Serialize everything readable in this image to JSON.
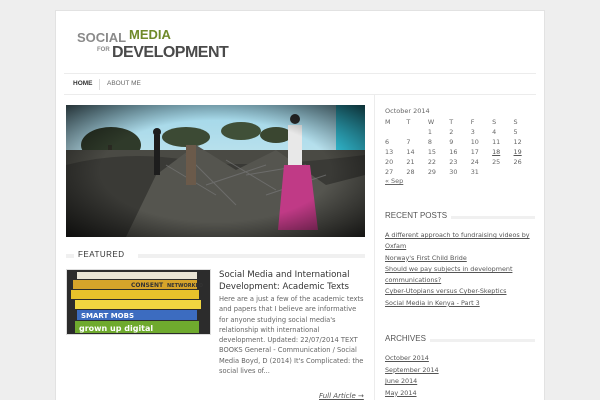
{
  "site": {
    "logo_social": "SOCIAL",
    "logo_media": "MEDIA",
    "logo_for": "FOR",
    "logo_development": "DEVELOPMENT"
  },
  "nav": {
    "home": "HOME",
    "about": "ABOUT ME"
  },
  "featured": {
    "heading": "FEATURED",
    "title": "Social Media and International Development: Academic Texts",
    "excerpt": "Here are a just a few of the academic texts and papers that I believe are informative for anyone studying social media's relationship with international development. Updated: 22/07/2014 TEXT BOOKS General - Communication / Social Media Boyd, D (2014) It's Complicated: the social lives of...",
    "full_article": "Full Article →",
    "thumb_books": [
      "",
      "CONSENT",
      "NETWORKED",
      "SMART MOBS",
      "grown up digital"
    ]
  },
  "calendar": {
    "caption": "October 2014",
    "headers": [
      "M",
      "T",
      "W",
      "T",
      "F",
      "S",
      "S"
    ],
    "rows": [
      [
        "",
        "",
        "1",
        "2",
        "3",
        "4",
        "5"
      ],
      [
        "6",
        "7",
        "8",
        "9",
        "10",
        "11",
        "12"
      ],
      [
        "13",
        "14",
        "15",
        "16",
        "17",
        "18",
        "19"
      ],
      [
        "20",
        "21",
        "22",
        "23",
        "24",
        "25",
        "26"
      ],
      [
        "27",
        "28",
        "29",
        "30",
        "31",
        "",
        ""
      ]
    ],
    "linked_days": [
      "18",
      "19"
    ],
    "prev": "« Sep"
  },
  "recent_posts": {
    "title": "RECENT POSTS",
    "items": [
      "A different approach to fundraising videos by Oxfam",
      "Norway's First Child Bride",
      "Should we pay subjects in development communications?",
      "Cyber-Utopians versus Cyber-Skeptics",
      "Social Media in Kenya - Part 3"
    ]
  },
  "archives": {
    "title": "ARCHIVES",
    "items": [
      "October 2014",
      "September 2014",
      "June 2014",
      "May 2014"
    ]
  },
  "colors": {
    "accent_green": "#6f8a2a",
    "logo_grey": "#8a8a8a",
    "background": "#eeeeee"
  }
}
